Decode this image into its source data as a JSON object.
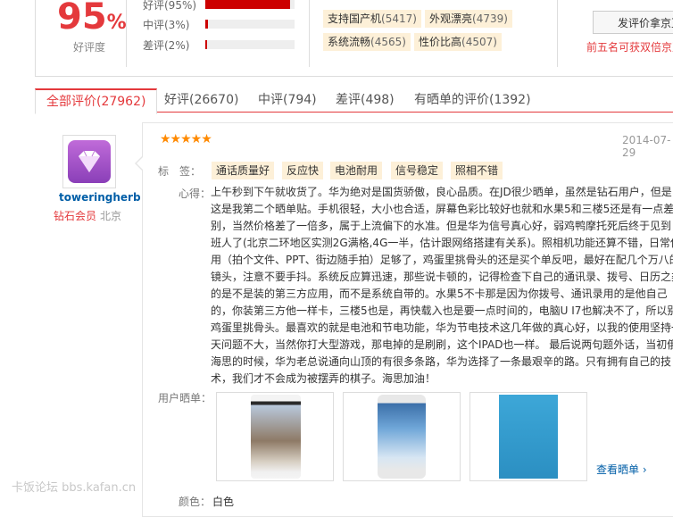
{
  "summary": {
    "percent": "95",
    "percent_unit": "%",
    "percent_label": "好评度",
    "rates": [
      {
        "label": "好评(95%)",
        "value": 0.95
      },
      {
        "label": "中评(3%)",
        "value": 0.03
      },
      {
        "label": "差评(2%)",
        "value": 0.02
      }
    ],
    "tags": [
      {
        "text": "支持国产机",
        "count": "(5417)"
      },
      {
        "text": "外观漂亮",
        "count": "(4739)"
      },
      {
        "text": "系统流畅",
        "count": "(4565)"
      },
      {
        "text": "性价比高",
        "count": "(4507)"
      }
    ],
    "review_button": "发评价拿京豆",
    "promo_text": "前五名可获双倍京豆"
  },
  "tabs": [
    {
      "label": "全部评价(27962)"
    },
    {
      "label": "好评(26670)"
    },
    {
      "label": "中评(794)"
    },
    {
      "label": "差评(498)"
    },
    {
      "label": "有晒单的评价(1392)"
    }
  ],
  "review": {
    "username": "toweringherb",
    "member_level": "钻石会员",
    "city": "北京",
    "stars": "★★★★★",
    "date": "2014-07-29",
    "tag_label": "标　签：",
    "tags": [
      "通话质量好",
      "反应快",
      "电池耐用",
      "信号稳定",
      "照相不错"
    ],
    "content_label": "心得：",
    "content_lines": [
      "上午秒到下午就收货了。华为绝对是国货骄傲，良心品质。在JD很少晒单，虽然是钻石用户，但是",
      "这是我第二个晒单贴。手机很轻，大小也合适，屏幕色彩比较好也就和水果5和三楼5还是有一点差",
      "别，当然价格差了一倍多，属于上流偏下的水准。但是华为信号真心好，弱鸡鸭摩托死后终于见到",
      "班人了(北京二环地区实测2G满格,4G一半，估计跟网络搭建有关系)。照相机功能还算不错，日常使",
      "用（拍个文件、PPT、街边随手拍）足够了，鸡蛋里挑骨头的还是买个单反吧，最好在配几个万八的",
      "镜头，注意不要手抖。系统反应算迅速，那些说卡顿的，记得检查下自己的通讯录、拨号、日历之类",
      "的是不是装的第三方应用，而不是系统自带的。水果5不卡那是因为你拨号、通讯录用的是他自己",
      "的，你装第三方他一样卡，三楼5也是，再快载入也是要一点时间的，电脑U I7也解决不了，所以别",
      "鸡蛋里挑骨头。最喜欢的就是电池和节电功能，华为节电技术这几年做的真心好，以我的使用坚持一",
      "天问题不大，当然你打大型游戏，那电掉的是刷刷，这个IPAD也一样。 最后说两句题外话，当初俄罗",
      "海思的时候，华为老总说通向山顶的有很多条路，华为选择了一条最艰辛的路。只有拥有自己的技",
      "术，我们才不会成为被摆弄的棋子。海思加油！"
    ],
    "photos_label": "用户晒单：",
    "see_more": "查看晒单",
    "color_label": "颜色：",
    "color_value": "白色"
  },
  "watermark": "卡饭论坛 bbs.kafan.cn",
  "colors": {
    "accent": "#e4393c",
    "tag_bg": "#fdf0d8",
    "link": "#005ea7",
    "star": "#ff8a00"
  }
}
